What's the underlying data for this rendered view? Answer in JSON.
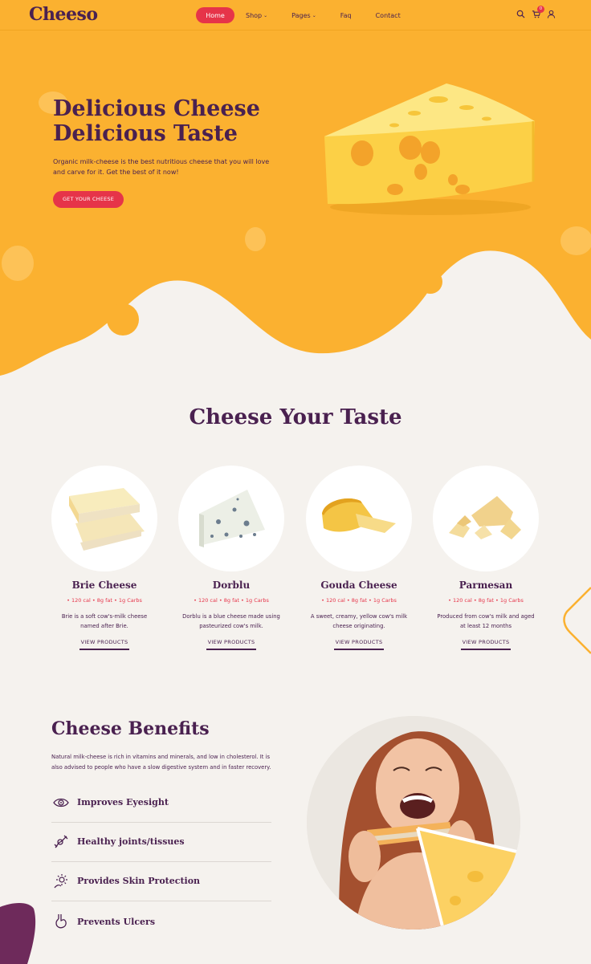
{
  "brand": {
    "logo": "Cheeso"
  },
  "nav": {
    "items": [
      {
        "label": "Home",
        "active": true,
        "dropdown": false
      },
      {
        "label": "Shop",
        "active": false,
        "dropdown": true
      },
      {
        "label": "Pages",
        "active": false,
        "dropdown": true
      },
      {
        "label": "Faq",
        "active": false,
        "dropdown": false
      },
      {
        "label": "Contact",
        "active": false,
        "dropdown": false
      }
    ],
    "cart_count": "0",
    "icons": [
      "search-icon",
      "cart-icon",
      "user-icon"
    ]
  },
  "hero": {
    "title_line1": "Delicious Cheese",
    "title_line2": "Delicious Taste",
    "text": "Organic milk-cheese is the best nutritious cheese that you will love and carve for it. Get the best of it now!",
    "button": "GET YOUR CHEESE"
  },
  "taste": {
    "title": "Cheese Your Taste",
    "products": [
      {
        "name": "Brie Cheese",
        "nutrition": "• 120 cal • 8g fat • 1g Carbs",
        "desc": "Brie is a soft cow's-milk cheese named after Brie.",
        "link": "VIEW PRODUCTS"
      },
      {
        "name": "Dorblu",
        "nutrition": "• 120 cal • 8g fat • 1g Carbs",
        "desc": "Dorblu is a blue cheese made using pasteurized cow's milk.",
        "link": "VIEW PRODUCTS"
      },
      {
        "name": "Gouda Cheese",
        "nutrition": "• 120 cal • 8g fat • 1g Carbs",
        "desc": "A sweet, creamy, yellow cow's milk cheese originating.",
        "link": "VIEW PRODUCTS"
      },
      {
        "name": "Parmesan",
        "nutrition": "• 120 cal • 8g fat • 1g Carbs",
        "desc": "Produced from cow's milk and aged at least 12 months",
        "link": "VIEW PRODUCTS"
      }
    ]
  },
  "benefits": {
    "title": "Cheese Benefits",
    "text": "Natural milk-cheese is rich in vitamins and minerals, and low in cholesterol. It is also advised to people who have a slow digestive system and in faster recovery.",
    "items": [
      {
        "label": "Improves Eyesight",
        "icon": "eye-icon"
      },
      {
        "label": "Healthy joints/tissues",
        "icon": "joint-icon"
      },
      {
        "label": "Provides Skin Protection",
        "icon": "sun-skin-icon"
      },
      {
        "label": "Prevents Ulcers",
        "icon": "stomach-icon"
      }
    ]
  },
  "colors": {
    "accent": "#e63449",
    "brand": "#4a2150",
    "cheese": "#fbb130",
    "background": "#f5f2ee"
  }
}
